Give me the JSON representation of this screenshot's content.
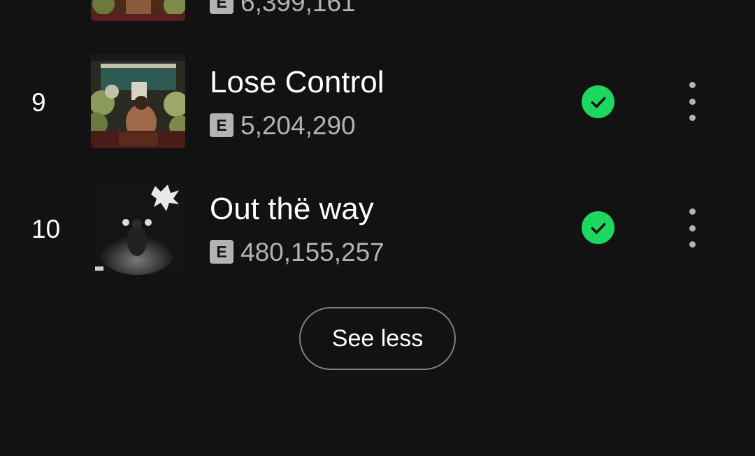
{
  "tracks": [
    {
      "number": "",
      "title": "",
      "explicit_label": "E",
      "plays": "6,399,161",
      "downloaded": true
    },
    {
      "number": "9",
      "title": "Lose Control",
      "explicit_label": "E",
      "plays": "5,204,290",
      "downloaded": true
    },
    {
      "number": "10",
      "title": "Out thë way",
      "explicit_label": "E",
      "plays": "480,155,257",
      "downloaded": true
    }
  ],
  "see_less_label": "See less",
  "colors": {
    "background": "#121212",
    "text_primary": "#ffffff",
    "text_secondary": "#b3b3b3",
    "accent_green": "#1ed760"
  },
  "icons": {
    "downloaded": "check-circle-icon",
    "more": "more-vertical-icon",
    "explicit": "explicit-badge"
  }
}
